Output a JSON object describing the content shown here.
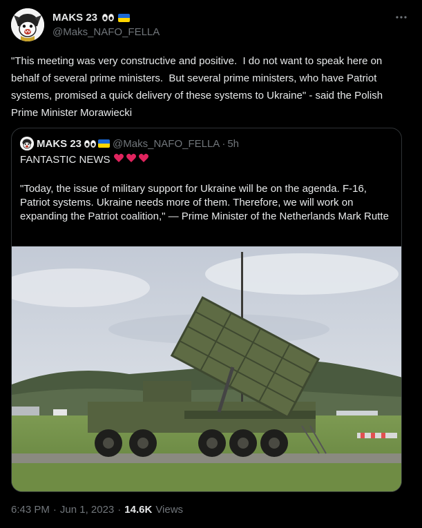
{
  "author": {
    "display_name": "MAKS 23",
    "handle": "@Maks_NAFO_FELLA"
  },
  "tweet": {
    "text": "\"This meeting was very constructive and positive.  I do not want to speak here on behalf of several prime ministers.  But several prime ministers, who have Patriot systems, promised a quick delivery of these systems to Ukraine\" - said the Polish Prime Minister Morawiecki"
  },
  "quote": {
    "display_name": "MAKS 23",
    "handle": "@Maks_NAFO_FELLA",
    "separator": "·",
    "time": "5h",
    "headline": "FANTASTIC NEWS",
    "body": "\"Today, the issue of military support for Ukraine will be on the agenda. F-16, Patriot systems. Ukraine needs more of them. Therefore, we will work on expanding the Patriot coalition,\" — Prime Minister of the Netherlands Mark Rutte"
  },
  "footer": {
    "time": "6:43 PM",
    "separator": "·",
    "date": "Jun 1, 2023",
    "separator2": "·",
    "views_count": "14.6K",
    "views_label": "Views"
  },
  "icons": {
    "avatar": "nafo-dog-avatar-icon",
    "eyes": "eyes-emoji-icon",
    "flag": "ukraine-flag-icon",
    "more": "more-options-icon",
    "heart": "red-heart-icon"
  },
  "colors": {
    "background": "#000000",
    "text": "#e7e9ea",
    "muted": "#71767b",
    "border": "#2f3336",
    "heart": "#f91880"
  }
}
